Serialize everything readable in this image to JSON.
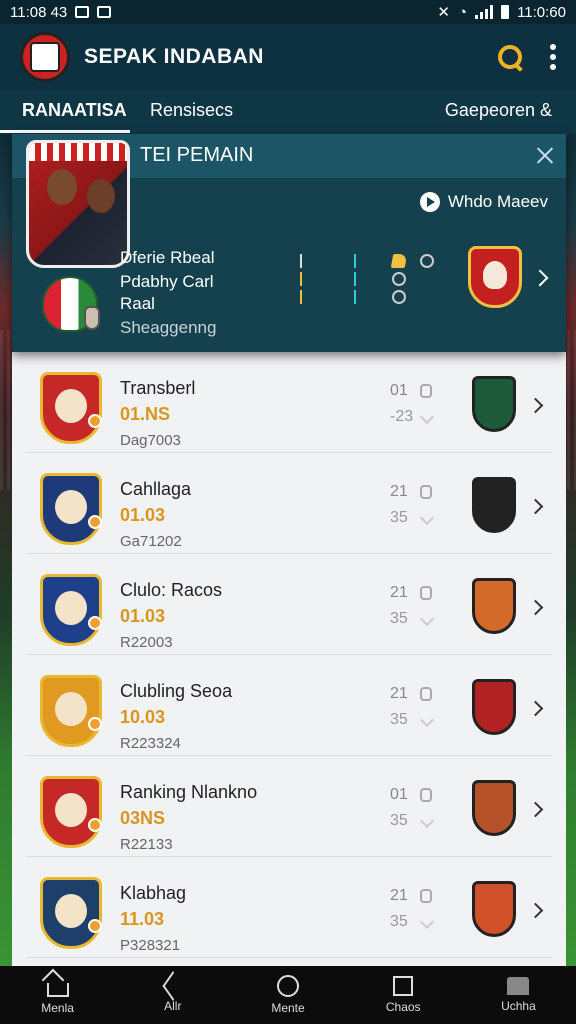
{
  "status_bar": {
    "time_left": "11:08 43",
    "time_right": "11:0:60"
  },
  "app": {
    "title": "SEPAK INDABAN"
  },
  "tabs": [
    {
      "label": "RANAATISA",
      "active": true
    },
    {
      "label": "Rensisecs",
      "active": false
    },
    {
      "label": "Gaepeoren &",
      "active": false
    }
  ],
  "featured": {
    "title": "TEI PEMAIN",
    "video_label": "Whdo Maeev",
    "lines": [
      "Dferie Rbeal",
      "Pdabhy Carl",
      "Raal",
      "Sheaggenng"
    ]
  },
  "list": [
    {
      "name": "Transberl",
      "rating": "01.NS",
      "code": "Dag7003",
      "num1": "01",
      "num2": "-23",
      "crest_color": "#c62828",
      "opp_color": "#1c5a3a"
    },
    {
      "name": "Cahllaga",
      "rating": "01.03",
      "code": "Ga71202",
      "num1": "21",
      "num2": "35",
      "crest_color": "#1f3a7a",
      "opp_color": "#222222"
    },
    {
      "name": "Clulo: Racos",
      "rating": "01.03",
      "code": "R22003",
      "num1": "21",
      "num2": "35",
      "crest_color": "#1e3f8a",
      "opp_color": "#d36a2a"
    },
    {
      "name": "Clubling Seoa",
      "rating": "10.03",
      "code": "R223324",
      "num1": "21",
      "num2": "35",
      "crest_color": "#e09a22",
      "opp_color": "#b22222"
    },
    {
      "name": "Ranking Nlankno",
      "rating": "03NS",
      "code": "R22133",
      "num1": "01",
      "num2": "35",
      "crest_color": "#c62828",
      "opp_color": "#b5522a"
    },
    {
      "name": "Klabhag",
      "rating": "11.03",
      "code": "P328321",
      "num1": "21",
      "num2": "35",
      "crest_color": "#1e3f6a",
      "opp_color": "#d0502a"
    }
  ],
  "bottom_nav": [
    {
      "label": "Menla",
      "icon": "home-icon"
    },
    {
      "label": "Allr",
      "icon": "back-icon"
    },
    {
      "label": "Mente",
      "icon": "circle-icon"
    },
    {
      "label": "Chaos",
      "icon": "square-icon"
    },
    {
      "label": "Uchha",
      "icon": "store-icon"
    }
  ]
}
